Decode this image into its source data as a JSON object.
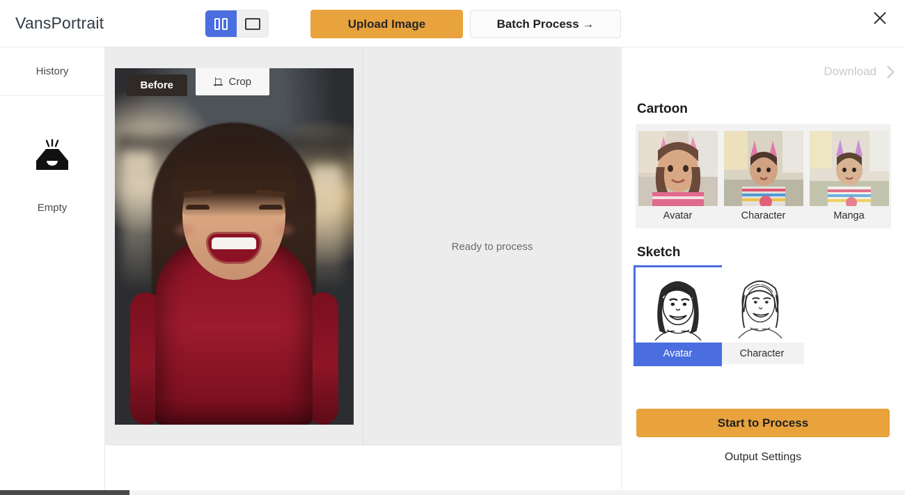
{
  "header": {
    "brand": "VansPortrait",
    "view_toggle": {
      "split_icon": "split-view-icon",
      "single_icon": "single-view-icon",
      "active": "split"
    },
    "upload_label": "Upload Image",
    "batch_label": "Batch Process →",
    "close_icon": "close-icon"
  },
  "sidebar": {
    "title": "History",
    "empty_icon": "empty-inbox-icon",
    "empty_label": "Empty"
  },
  "workspace": {
    "before_tab": "Before",
    "crop_label": "Crop",
    "crop_icon": "crop-icon",
    "status": "Ready to process"
  },
  "right_panel": {
    "download_label": "Download",
    "download_chevron": "chevron-right-icon",
    "cartoon": {
      "title": "Cartoon",
      "styles": [
        {
          "label": "Avatar"
        },
        {
          "label": "Character"
        },
        {
          "label": "Manga"
        }
      ]
    },
    "sketch": {
      "title": "Sketch",
      "styles": [
        {
          "label": "Avatar",
          "selected": true
        },
        {
          "label": "Character",
          "selected": false
        }
      ]
    },
    "start_label": "Start to Process",
    "output_settings_label": "Output Settings"
  },
  "colors": {
    "accent_orange": "#e8a33d",
    "accent_blue": "#4a6ee0",
    "workspace_grey": "#ececec",
    "disabled_grey": "#c9c9c9"
  }
}
